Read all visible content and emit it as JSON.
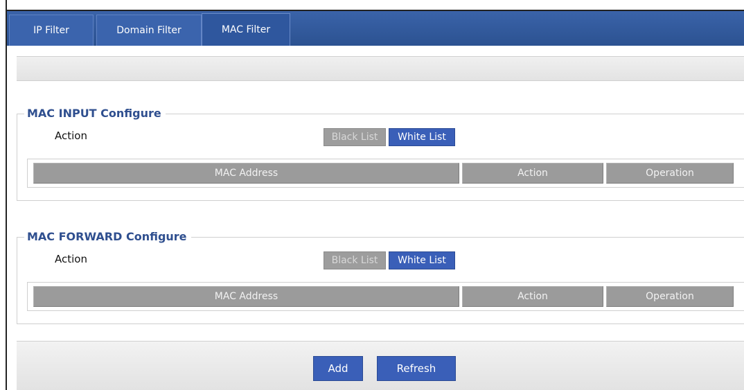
{
  "tabs": [
    {
      "label": "IP Filter"
    },
    {
      "label": "Domain Filter"
    },
    {
      "label": "MAC Filter"
    }
  ],
  "active_tab": "MAC Filter",
  "mac_input": {
    "title": "MAC INPUT Configure",
    "action_label": "Action",
    "black_list_label": "Black List",
    "white_list_label": "White List",
    "columns": [
      "MAC Address",
      "Action",
      "Operation"
    ]
  },
  "mac_forward": {
    "title": "MAC FORWARD Configure",
    "action_label": "Action",
    "black_list_label": "Black List",
    "white_list_label": "White List",
    "columns": [
      "MAC Address",
      "Action",
      "Operation"
    ]
  },
  "footer": {
    "add_label": "Add",
    "refresh_label": "Refresh"
  },
  "colors": {
    "tabbar": "#2f5597",
    "accent_button": "#3a5fb8",
    "disabled_button": "#9d9d9d",
    "table_header": "#9b9b9b",
    "legend_text": "#2f4f8f"
  }
}
